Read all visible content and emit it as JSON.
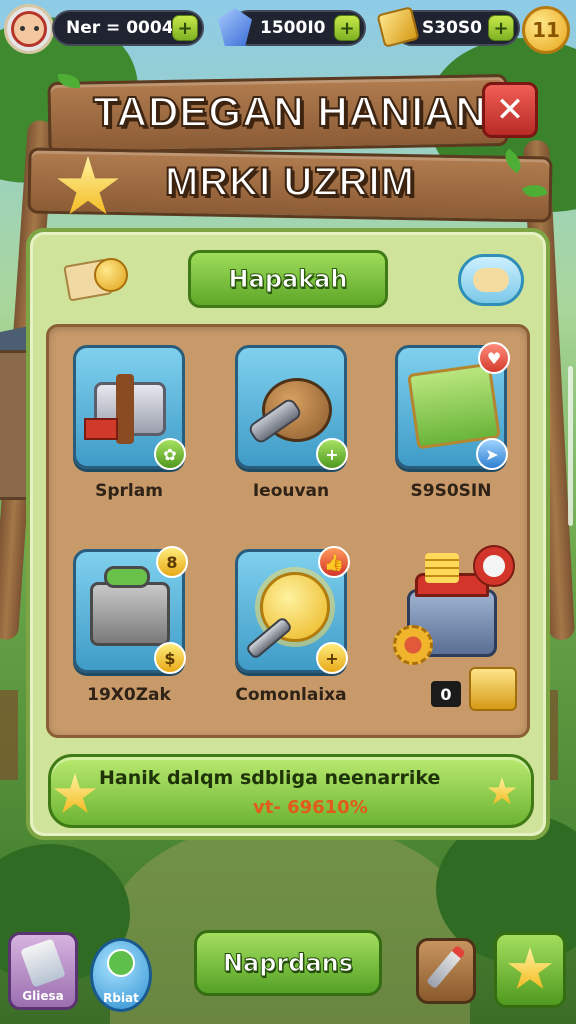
{
  "hud": {
    "player_label": "Ner = 0004",
    "gems_value": "1500I0",
    "gold_value": "S30S0",
    "plus_symbol": "+",
    "coin_button_symbol": "11"
  },
  "title": {
    "line1": "TADEGAN HANIAN",
    "line2": "MRKI UZRIM",
    "close_symbol": "✕"
  },
  "panel": {
    "tab_label": "Hapakah",
    "items": [
      {
        "label": "Sprlam",
        "badge": "✿"
      },
      {
        "label": "Ieouvan",
        "badge": "+"
      },
      {
        "label": "S9S0SIN",
        "badge": "♥"
      },
      {
        "label": "19X0Zak",
        "badge": "8"
      },
      {
        "label": "Comonlaixa",
        "badge": "+"
      },
      {
        "label": "",
        "count": "0"
      }
    ],
    "banner": {
      "text": "Hanik dalqm sdbliga neenarrike",
      "sub": "vt- 69610%"
    }
  },
  "bottom": {
    "left_button_label": "Gliesa",
    "heart_button_label": "Rbiat",
    "main_button_label": "Naprdans"
  },
  "colors": {
    "panel_bg": "#cfe49a",
    "accent_green": "#5ea828",
    "wood": "#8c5c36",
    "close_red": "#b82b25"
  }
}
